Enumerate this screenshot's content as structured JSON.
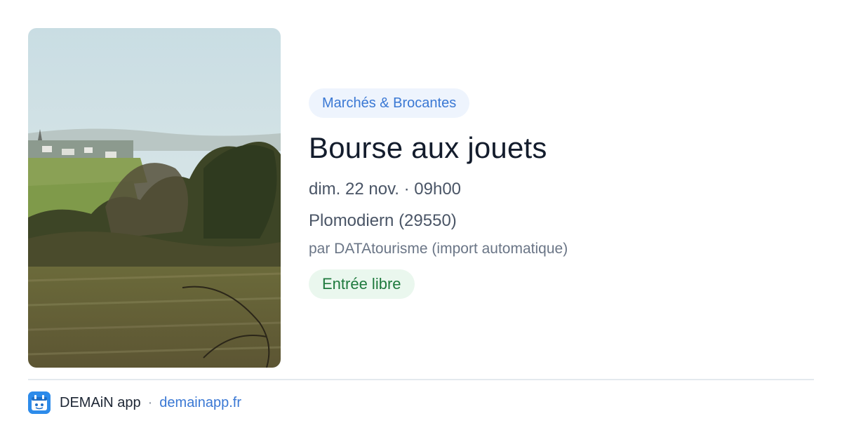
{
  "image": {
    "subject": "countryside-landscape-photo"
  },
  "event": {
    "category": "Marchés & Brocantes",
    "title": "Bourse aux jouets",
    "datetime": "dim. 22 nov. · 09h00",
    "place": "Plomodiern (29550)",
    "source": "par DATAtourisme (import automatique)",
    "price": "Entrée libre"
  },
  "footer": {
    "app_name": "DEMAiN app",
    "separator": "·",
    "link": "demainapp.fr"
  },
  "colors": {
    "category_bg": "#eef4fd",
    "category_text": "#3a78d4",
    "price_bg": "#eaf7ee",
    "price_text": "#1f7a3e",
    "title_text": "#131c2c",
    "brand_blue": "#2d8bea"
  }
}
